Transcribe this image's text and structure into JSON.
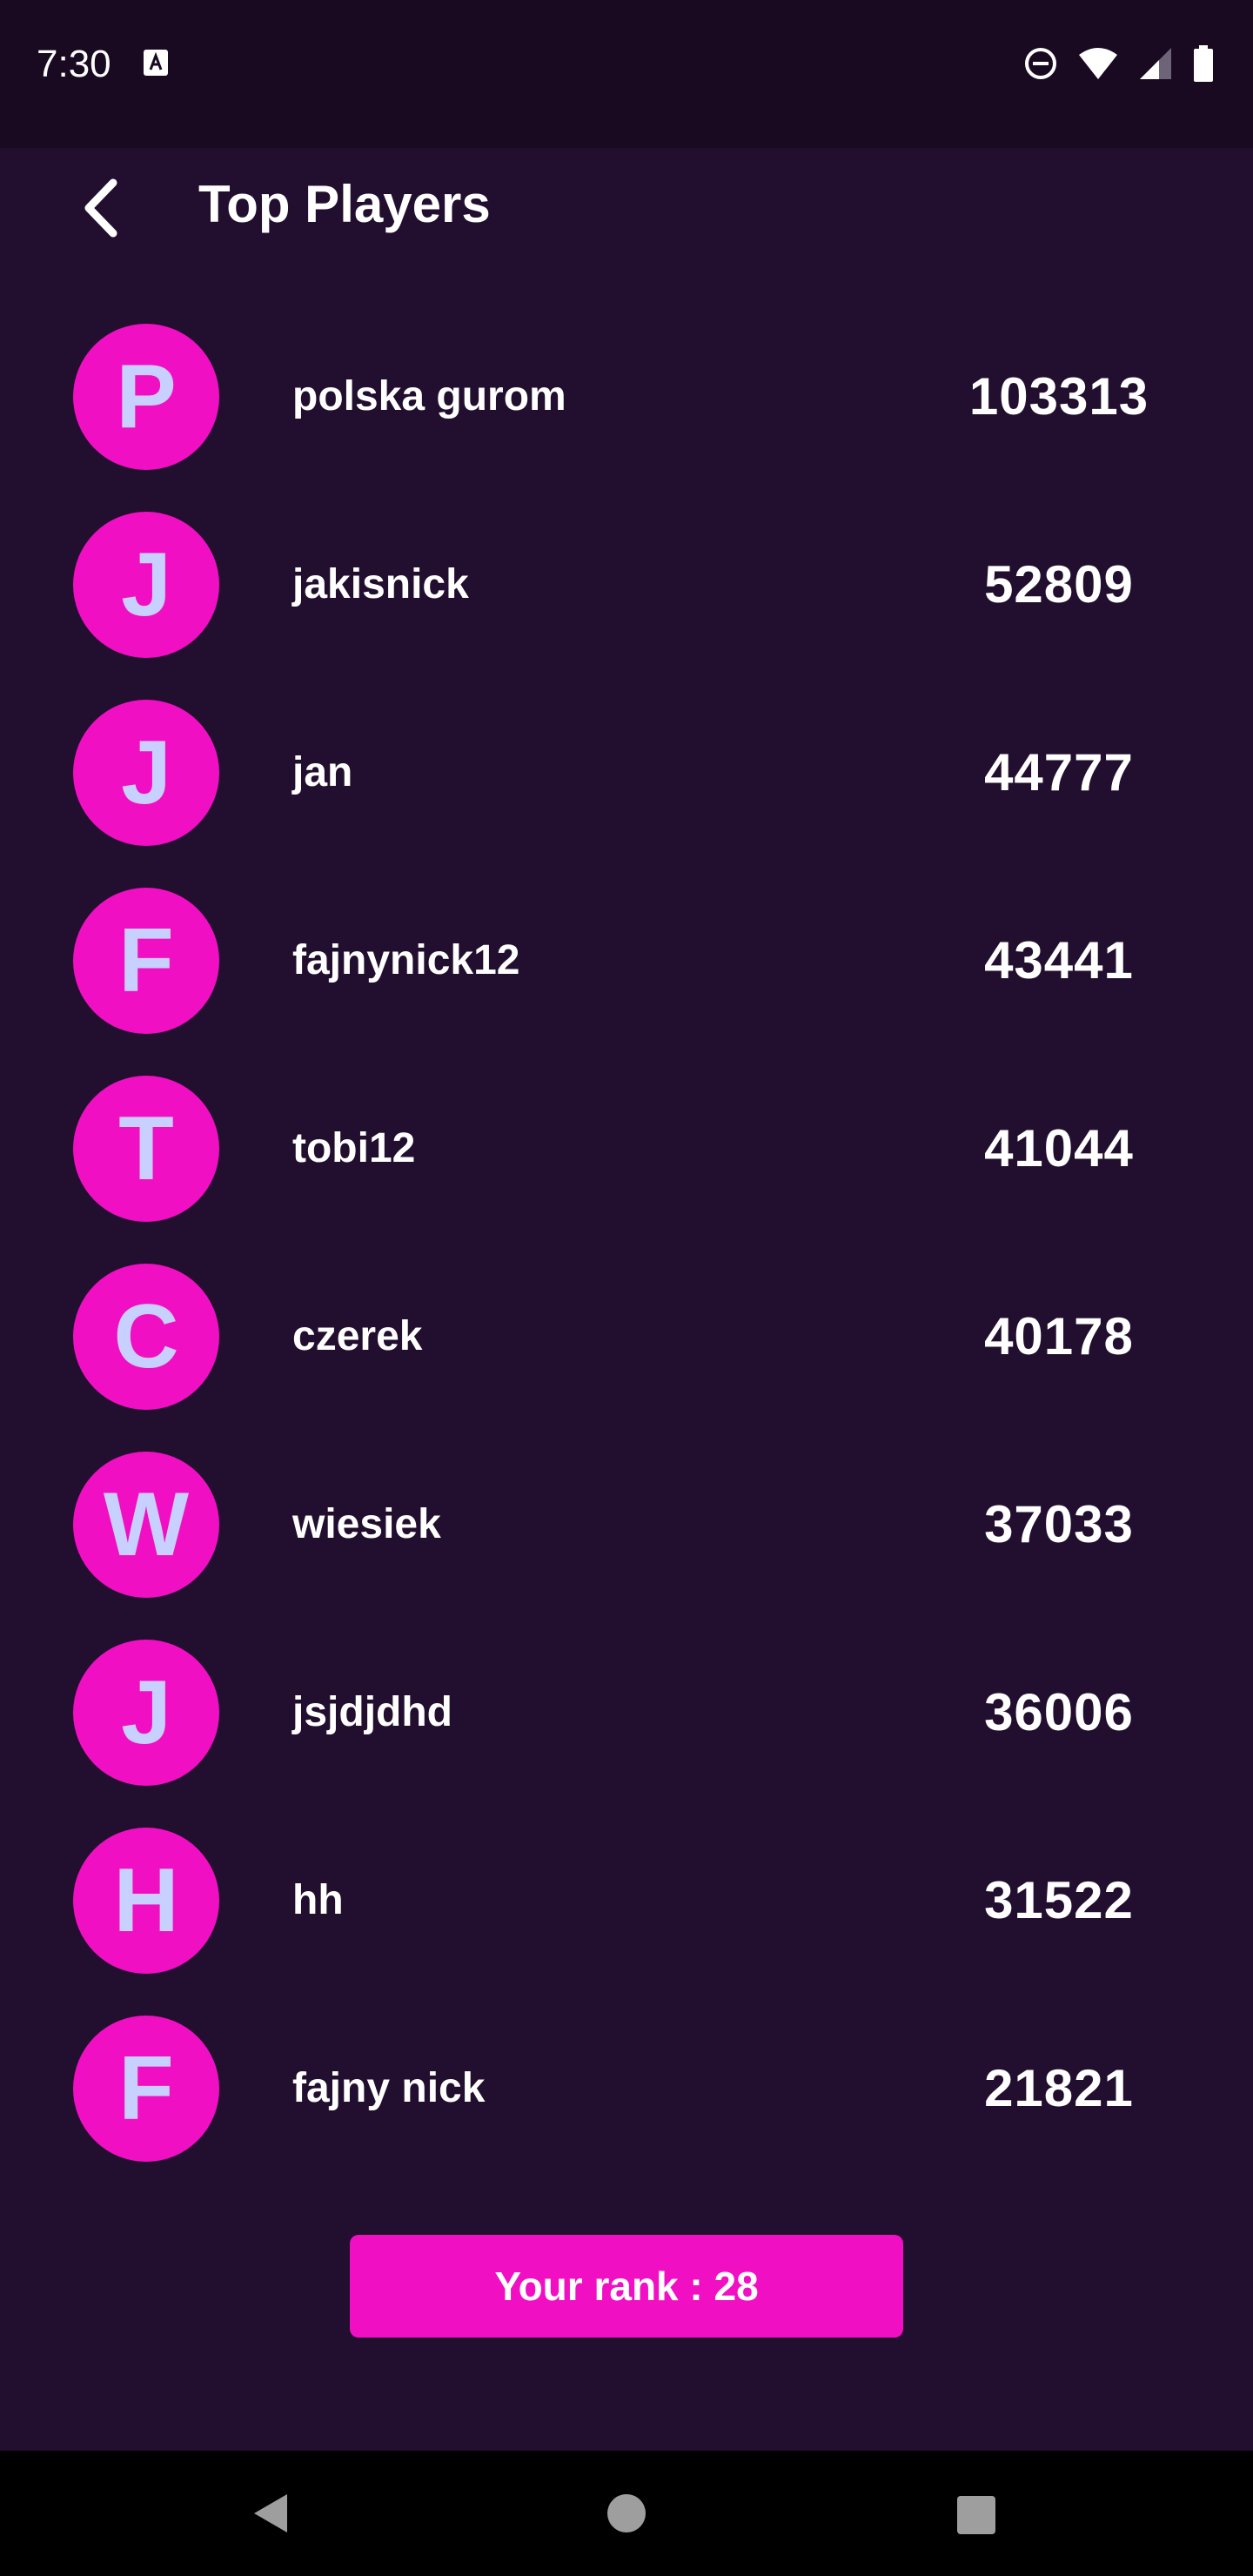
{
  "status_bar": {
    "time": "7:30",
    "icons": [
      "a-notification-icon",
      "dnd-icon",
      "wifi-icon",
      "signal-icon",
      "battery-icon"
    ]
  },
  "app_bar": {
    "title": "Top Players",
    "back_icon": "chevron-left-icon"
  },
  "players": [
    {
      "initial": "P",
      "name": "polska gurom",
      "score": "103313"
    },
    {
      "initial": "J",
      "name": "jakisnick",
      "score": "52809"
    },
    {
      "initial": "J",
      "name": "jan",
      "score": "44777"
    },
    {
      "initial": "F",
      "name": "fajnynick12",
      "score": "43441"
    },
    {
      "initial": "T",
      "name": "tobi12",
      "score": "41044"
    },
    {
      "initial": "C",
      "name": "czerek",
      "score": "40178"
    },
    {
      "initial": "W",
      "name": "wiesiek",
      "score": "37033"
    },
    {
      "initial": "J",
      "name": "jsjdjdhd",
      "score": "36006"
    },
    {
      "initial": "H",
      "name": "hh",
      "score": "31522"
    },
    {
      "initial": "F",
      "name": "fajny nick",
      "score": "21821"
    }
  ],
  "rank_button": {
    "label": "Your rank : 28"
  },
  "nav_bar": {
    "icons": [
      "nav-back-icon",
      "nav-home-icon",
      "nav-recents-icon"
    ]
  },
  "colors": {
    "background": "#220e2e",
    "status_bar": "#190a22",
    "accent": "#f10fc4",
    "avatar_letter": "#c7d0ff",
    "text": "#ffffff"
  }
}
